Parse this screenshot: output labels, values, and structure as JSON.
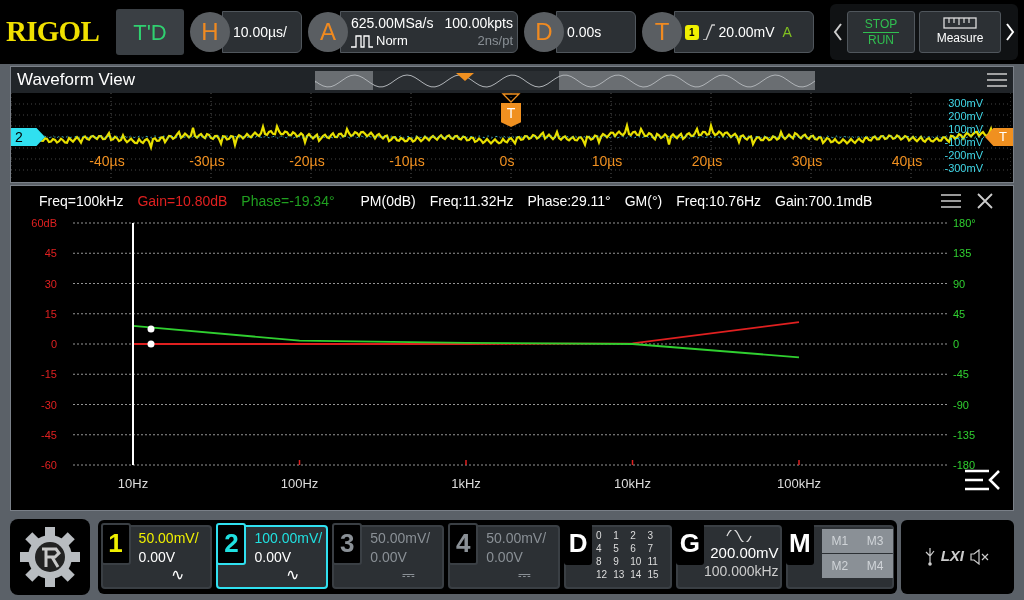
{
  "top_bar": {
    "logo": "RIGOL",
    "mode": "T'D",
    "horizontal": {
      "letter": "H",
      "value": "10.00µs/"
    },
    "acquire": {
      "letter": "A",
      "sample_rate": "625.00MSa/s",
      "memory_depth": "100.00kpts",
      "mode": "Norm",
      "interval": "2ns/pt"
    },
    "delay": {
      "letter": "D",
      "value": "0.00s"
    },
    "trigger": {
      "letter": "T",
      "source": "1",
      "level": "20.00mV",
      "sweep": "A"
    },
    "run_control": {
      "stop": "STOP",
      "run": "RUN"
    },
    "measure": "Measure"
  },
  "waveform_view": {
    "title": "Waveform View",
    "channel_marker": "2",
    "trigger_marker": "T",
    "trigger_level_marker": "T",
    "time_labels": [
      "-40µs",
      "-30µs",
      "-20µs",
      "-10µs",
      "0s",
      "10µs",
      "20µs",
      "30µs",
      "40µs"
    ],
    "volt_labels": [
      "300mV",
      "200mV",
      "100mV",
      "-100mV",
      "-200mV",
      "-300mV"
    ]
  },
  "bode_plot": {
    "readouts": [
      {
        "text": "Freq=100kHz",
        "color": "#ffffff"
      },
      {
        "text": "Gain=10.80dB",
        "color": "#e02020"
      },
      {
        "text": "Phase=-19.34°",
        "color": "#20a020"
      },
      {
        "text": "PM(0dB)",
        "color": "#ffffff"
      },
      {
        "text": "Freq:11.32Hz",
        "color": "#ffffff"
      },
      {
        "text": "Phase:29.11°",
        "color": "#ffffff"
      },
      {
        "text": "GM(°)",
        "color": "#ffffff"
      },
      {
        "text": "Freq:10.76Hz",
        "color": "#ffffff"
      },
      {
        "text": "Gain:700.1mdB",
        "color": "#ffffff"
      }
    ],
    "phase_axis_labels": [
      "180°",
      "135",
      "90",
      "45",
      "0",
      "-45",
      "-90",
      "-135",
      "-180"
    ],
    "chart_data": {
      "type": "line",
      "ylim": [
        -60,
        60
      ],
      "grid": true,
      "categories": [
        "10Hz",
        "100Hz",
        "1kHz",
        "10kHz",
        "100kHz"
      ],
      "series": [
        {
          "color": "#e02020",
          "values": [
            0,
            0,
            0,
            0.3,
            10.8
          ]
        },
        {
          "color": "#30d030",
          "values": [
            9,
            1.7,
            0.6,
            0,
            -6.6
          ]
        }
      ],
      "yticks": [
        {
          "value": 60,
          "label": "60dB"
        },
        {
          "value": 45,
          "label": "45"
        },
        {
          "value": 30,
          "label": "30"
        },
        {
          "value": 15,
          "label": "15"
        },
        {
          "value": 0,
          "label": "0"
        },
        {
          "value": -15,
          "label": "-15"
        },
        {
          "value": -30,
          "label": "-30"
        },
        {
          "value": -45,
          "label": "-45"
        },
        {
          "value": -60,
          "label": "-60"
        }
      ]
    }
  },
  "channels": [
    {
      "number": "1",
      "scale": "50.00mV/",
      "offset": "0.00V",
      "coupling": "∿",
      "enabled": true,
      "selected": false,
      "color": "#f0f000"
    },
    {
      "number": "2",
      "scale": "100.00mV/",
      "offset": "0.00V",
      "coupling": "∿",
      "enabled": true,
      "selected": true,
      "color": "#20e0e0"
    },
    {
      "number": "3",
      "scale": "50.00mV/",
      "offset": "0.00V",
      "coupling": "⎓",
      "enabled": false,
      "selected": false
    },
    {
      "number": "4",
      "scale": "50.00mV/",
      "offset": "0.00V",
      "coupling": "⎓",
      "enabled": false,
      "selected": false
    }
  ],
  "digital": {
    "letter": "D",
    "channels": [
      "0",
      "1",
      "2",
      "3",
      "4",
      "5",
      "6",
      "7",
      "8",
      "9",
      "10",
      "11",
      "12",
      "13",
      "14",
      "15"
    ]
  },
  "generator": {
    "letter": "G",
    "amplitude": "200.00mV",
    "frequency": "100.000kHz"
  },
  "math": {
    "letter": "M",
    "items": [
      "M1",
      "M3",
      "M2",
      "M4"
    ]
  },
  "status": {
    "lxi": "LXI"
  }
}
